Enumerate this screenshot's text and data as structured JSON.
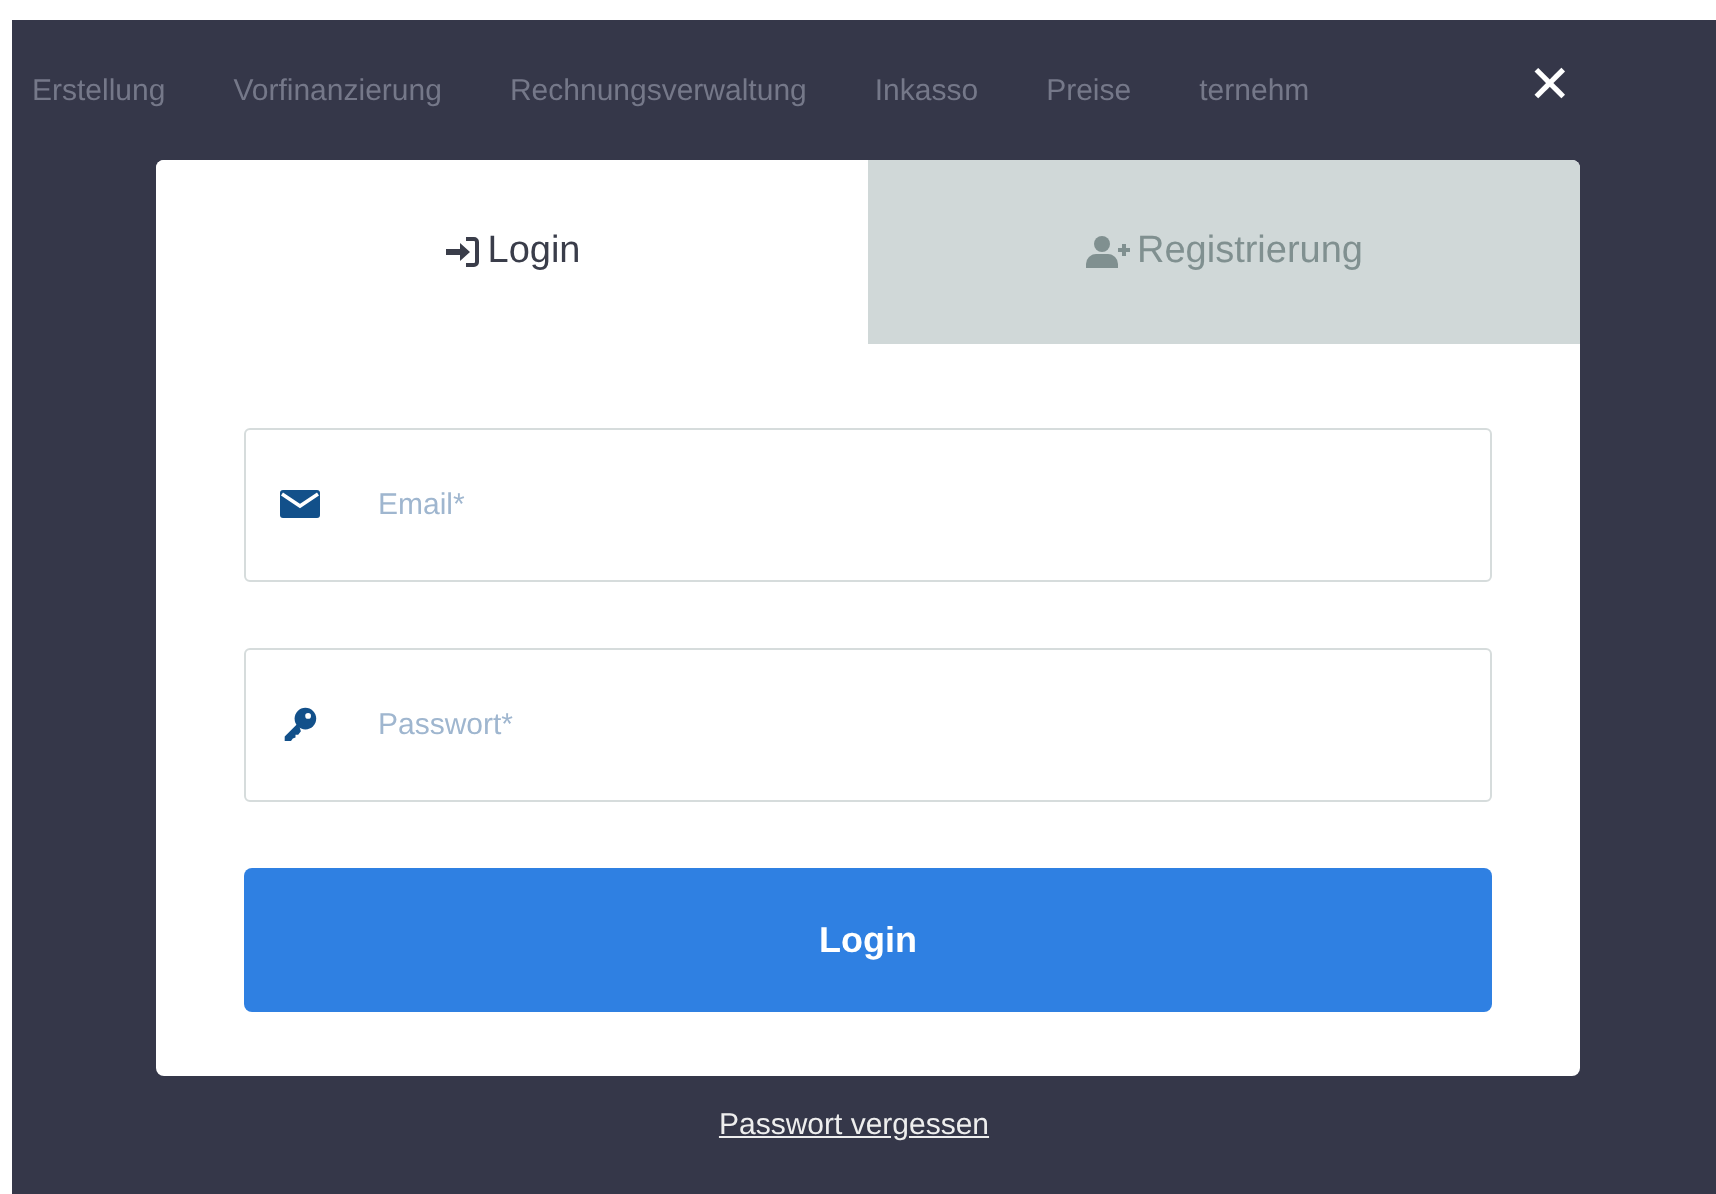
{
  "background_nav": {
    "items": [
      "Erstellung",
      "Vorfinanzierung",
      "Rechnungsverwaltung",
      "Inkasso",
      "Preise",
      "ternehm"
    ]
  },
  "close_button": {
    "label": "✕"
  },
  "tabs": [
    {
      "label": "Login",
      "kind": "login",
      "selected": true
    },
    {
      "label": "Registrierung",
      "kind": "register",
      "selected": false
    }
  ],
  "fields": [
    {
      "kind": "email",
      "placeholder": "Email*"
    },
    {
      "kind": "password",
      "placeholder": "Passwort*"
    }
  ],
  "submit_button": {
    "label": "Login"
  },
  "forgot_link": {
    "label": "Passwort vergessen"
  }
}
